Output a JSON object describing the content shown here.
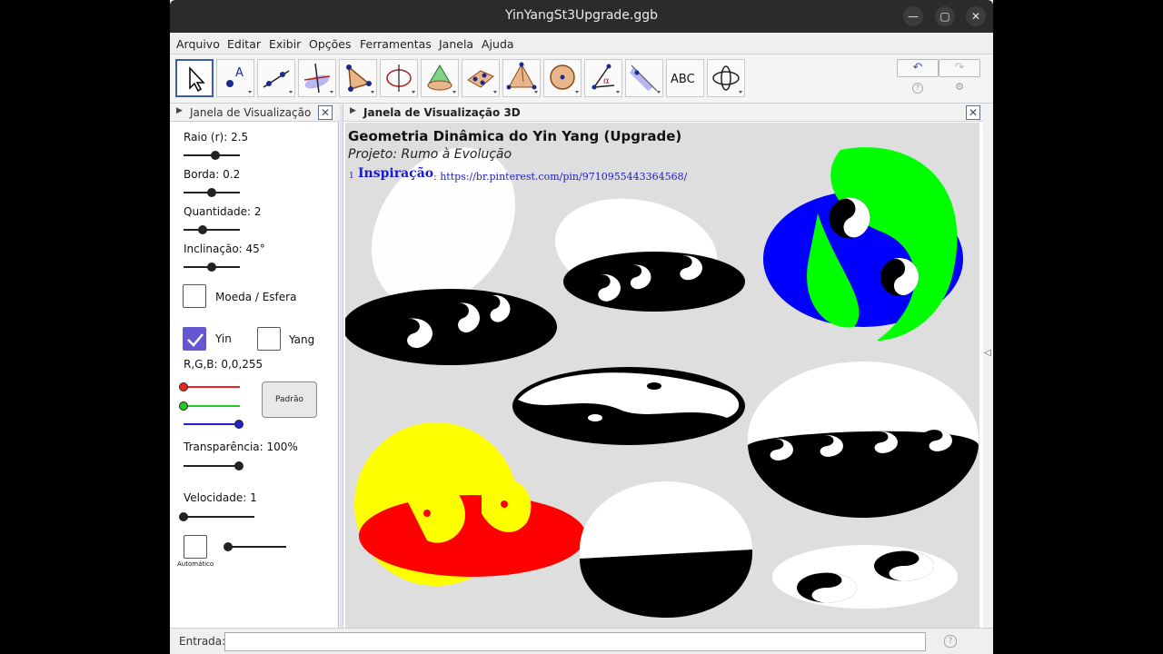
{
  "window": {
    "title": "YinYangSt3Upgrade.ggb"
  },
  "menubar": {
    "items": [
      "Arquivo",
      "Editar",
      "Exibir",
      "Opções",
      "Ferramentas",
      "Janela",
      "Ajuda"
    ]
  },
  "toolbar": {
    "tools": [
      {
        "icon": "move-arrow-icon",
        "selected": true
      },
      {
        "icon": "point-icon",
        "label": "A"
      },
      {
        "icon": "line-icon"
      },
      {
        "icon": "perpendicular-line-icon"
      },
      {
        "icon": "polygon-icon"
      },
      {
        "icon": "circle-axis-icon"
      },
      {
        "icon": "pyramid-cone-icon"
      },
      {
        "icon": "plane-icon"
      },
      {
        "icon": "tetrahedron-icon"
      },
      {
        "icon": "sphere-icon"
      },
      {
        "icon": "angle-icon",
        "label": "α"
      },
      {
        "icon": "reflect-icon"
      },
      {
        "icon": "text-icon",
        "label": "ABC"
      },
      {
        "icon": "rotate-view-icon"
      }
    ]
  },
  "left_panel": {
    "title": "Janela de Visualização",
    "raio_label": "Raio (r): 2.5",
    "borda_label": "Borda: 0.2",
    "quantidade_label": "Quantidade: 2",
    "inclinacao_label": "Inclinação: 45°",
    "moeda_label": "Moeda / Esfera",
    "moeda_checked": false,
    "yin_label": "Yin",
    "yin_checked": true,
    "yang_label": "Yang",
    "yang_checked": false,
    "rgb_label": "R,G,B: 0,0,255",
    "padrao_label": "Padrão",
    "transparencia_label": "Transparência: 100%",
    "velocidade_label": "Velocidade: 1",
    "automatico_label": "Automático",
    "automatico_checked": false,
    "sliders": {
      "raio": 0.45,
      "borda": 0.4,
      "quantidade": 0.25,
      "inclinacao": 0.5,
      "red": 0.0,
      "green": 0.0,
      "blue": 1.0,
      "transparencia": 1.0,
      "velocidade": 0.0,
      "automatico": 0.0
    }
  },
  "view3d": {
    "title": "Janela de Visualização 3D",
    "heading": "Geometria Dinâmica do Yin Yang (Upgrade)",
    "subtitle": "Projeto: Rumo à Evolução",
    "inspiracao_num": "1",
    "inspiracao_label": "Inspiração",
    "inspiracao_url": ": https://br.pinterest.com/pin/9710955443364568/"
  },
  "input_bar": {
    "label": "Entrada:",
    "value": ""
  },
  "colors": {
    "accent": "#3b5ca8",
    "checkbox_on": "#6557d2",
    "yin_blue": "#0000ff",
    "green": "#00ff00",
    "yellow": "#ffff00",
    "red": "#ff0000"
  }
}
